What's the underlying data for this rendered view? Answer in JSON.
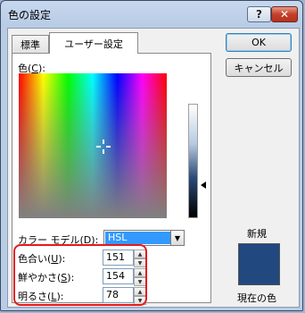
{
  "window": {
    "title": "色の設定",
    "help_label": "?",
    "close_label": "✕"
  },
  "tabs": [
    {
      "label": "標準",
      "selected": false
    },
    {
      "label": "ユーザー設定",
      "selected": true
    }
  ],
  "picker": {
    "color_label_pre": "色(",
    "color_label_key": "C",
    "color_label_post": "):"
  },
  "color_model": {
    "label_pre": "カラー モデル(",
    "label_key": "D",
    "label_post": "):",
    "value": "HSL",
    "dropdown_icon": "▼"
  },
  "fields": [
    {
      "label_pre": "色合い(",
      "key": "U",
      "label_post": "):",
      "value": "151"
    },
    {
      "label_pre": "鮮やかさ(",
      "key": "S",
      "label_post": "):",
      "value": "154"
    },
    {
      "label_pre": "明るさ(",
      "key": "L",
      "label_post": "):",
      "value": "78"
    }
  ],
  "spin_up_icon": "▲",
  "spin_down_icon": "▼",
  "buttons": {
    "ok": "OK",
    "cancel": "キャンセル"
  },
  "preview": {
    "new_label": "新規",
    "current_label": "現在の色",
    "color": "#22497f"
  },
  "colors": {
    "highlight": "#e6191c",
    "selection": "#3399ff"
  }
}
